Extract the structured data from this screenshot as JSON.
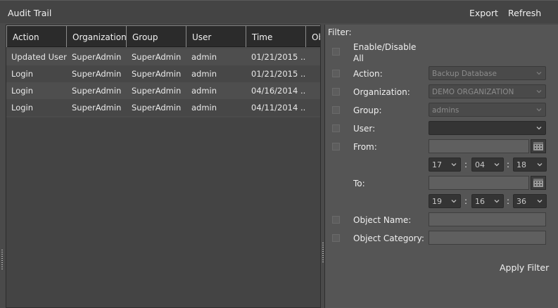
{
  "window": {
    "title": "Audit Trail"
  },
  "toolbar": {
    "export_label": "Export",
    "refresh_label": "Refresh"
  },
  "grid": {
    "columns": [
      "Action",
      "Organization",
      "Group",
      "User",
      "Time",
      "Ob"
    ],
    "rows": [
      [
        "Updated User",
        "SuperAdmin",
        "SuperAdmin",
        "admin",
        "01/21/2015 ..."
      ],
      [
        "Login",
        "SuperAdmin",
        "SuperAdmin",
        "admin",
        "01/21/2015 ..."
      ],
      [
        "Login",
        "SuperAdmin",
        "SuperAdmin",
        "admin",
        "04/16/2014 ..."
      ],
      [
        "Login",
        "SuperAdmin",
        "SuperAdmin",
        "admin",
        "04/11/2014 ..."
      ]
    ]
  },
  "filter": {
    "heading": "Filter:",
    "enable_all_line1": "Enable/Disable",
    "enable_all_line2": "All",
    "action_label": "Action:",
    "action_value": "Backup Database",
    "organization_label": "Organization:",
    "organization_value": "DEMO ORGANIZATION",
    "group_label": "Group:",
    "group_value": "admins",
    "user_label": "User:",
    "user_value": "",
    "from_label": "From:",
    "from_date": "",
    "from_hour": "17",
    "from_minute": "04",
    "from_second": "18",
    "to_label": "To:",
    "to_date": "",
    "to_hour": "19",
    "to_minute": "16",
    "to_second": "36",
    "time_separator": ":",
    "object_name_label": "Object Name:",
    "object_name_value": "",
    "object_category_label": "Object Category:",
    "object_category_value": "",
    "apply_label": "Apply Filter"
  }
}
